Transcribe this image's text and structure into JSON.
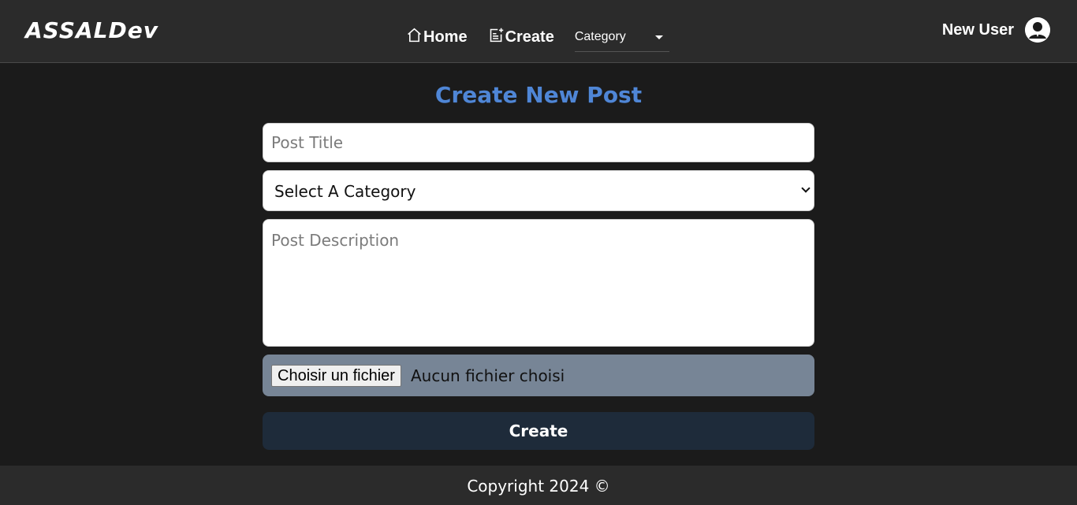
{
  "header": {
    "logo": "ASSALDev",
    "nav": {
      "home_label": "Home",
      "create_label": "Create",
      "category_label": "Category"
    },
    "user_name": "New User",
    "home_icon": "house-icon",
    "create_icon": "note-add-icon",
    "avatar_icon": "user-avatar-icon"
  },
  "form": {
    "title": "Create New Post",
    "post_title_placeholder": "Post Title",
    "category_select_value": "Select A Category",
    "description_placeholder": "Post Description",
    "file_button_label": "Choisir un fichier",
    "file_status": "Aucun fichier choisi",
    "submit_label": "Create"
  },
  "footer": {
    "copyright": "Copyright 2024 ©"
  },
  "colors": {
    "background": "#1b1b1b",
    "header": "#2b2b2b",
    "title_accent": "#4f86d6",
    "file_area": "#778596",
    "create_button": "#1e2b3a"
  }
}
